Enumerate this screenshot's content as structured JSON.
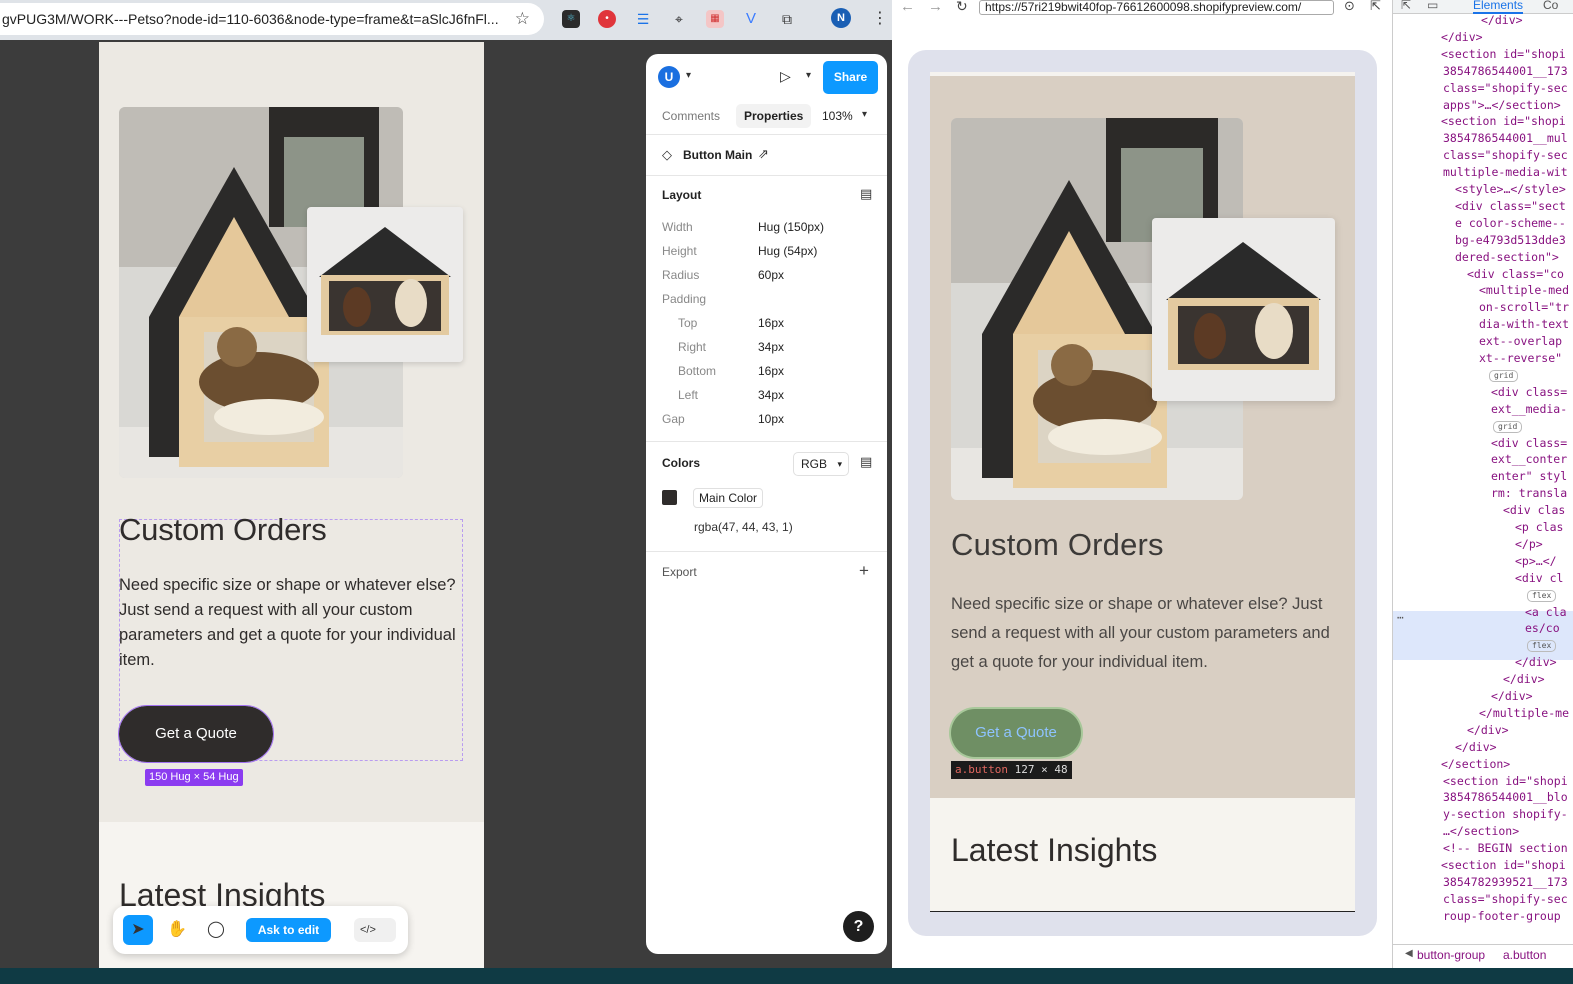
{
  "left_browser": {
    "url": "gvPUG3M/WORK---Petso?node-id=110-6036&node-type=frame&t=aSlcJ6fnFl...",
    "profile_initial": "N"
  },
  "figma_canvas": {
    "heading": "Custom Orders",
    "body": "Need specific size or shape or whatever else? Just send a request with all your custom parameters and get a quote for your individual item.",
    "button_label": "Get a Quote",
    "size_badge": "150 Hug × 54 Hug",
    "next_heading": "Latest Insights"
  },
  "figma_toolbar": {
    "ask_label": "Ask to edit",
    "code_label": "</>"
  },
  "properties_panel": {
    "user_initial": "U",
    "share_label": "Share",
    "tabs": [
      "Comments",
      "Properties"
    ],
    "zoom": "103%",
    "component_name": "Button Main",
    "layout_title": "Layout",
    "layout": [
      {
        "label": "Width",
        "value": "Hug (150px)"
      },
      {
        "label": "Height",
        "value": "Hug (54px)"
      },
      {
        "label": "Radius",
        "value": "60px"
      },
      {
        "label": "Padding",
        "value": ""
      },
      {
        "label": "Top",
        "value": "16px"
      },
      {
        "label": "Right",
        "value": "34px"
      },
      {
        "label": "Bottom",
        "value": "16px"
      },
      {
        "label": "Left",
        "value": "34px"
      },
      {
        "label": "Gap",
        "value": "10px"
      }
    ],
    "colors_title": "Colors",
    "color_mode": "RGB",
    "color_name": "Main Color",
    "color_value": "rgba(47, 44, 43, 1)",
    "color_hex": "#2f2c2b",
    "export_title": "Export",
    "help": "?"
  },
  "right_browser": {
    "url": "https://57ri219bwit40fop-76612600098.shopifypreview.com/",
    "heading": "Custom Orders",
    "body": "Need specific size or shape or whatever else? Just send a request with all your custom parameters and get a quote for your individual item.",
    "button_label": "Get a Quote",
    "tooltip_tag": "a.button",
    "tooltip_size": "127 × 48",
    "next_heading": "Latest Insights"
  },
  "devtools": {
    "tabs": [
      "Elements",
      "Co"
    ],
    "lines": [
      "</div>",
      "</div>",
      "<section id=\"shopi",
      "3854786544001__173",
      "class=\"shopify-sec",
      "apps\">…</section>",
      "<section id=\"shopi",
      "3854786544001__mul",
      "class=\"shopify-sec",
      "multiple-media-wit",
      "<style>…</style>",
      "<div class=\"sect",
      "e color-scheme--",
      "bg-e4793d513dde3",
      "dered-section\">",
      "<div class=\"co",
      "<multiple-med",
      "on-scroll=\"tr",
      "dia-with-text",
      "ext--overlap",
      "xt--reverse\"",
      "grid",
      "<div class=",
      "ext__media-",
      "grid",
      "<div class=",
      "ext__conter",
      "enter\" styl",
      "rm: transla",
      "<div clas",
      "<p clas",
      "</p>",
      "<p>…</",
      "<div cl",
      "flex",
      "<a cla",
      "es/co",
      "flex",
      "</div>",
      "</div>",
      "</div>",
      "</multiple-me",
      "</div>",
      "</div>",
      "</section>",
      "<section id=\"shopi",
      "3854786544001__blo",
      "y-section shopify-",
      "…</section>",
      "<!-- BEGIN section",
      "<section id=\"shopi",
      "3854782939521__173",
      "class=\"shopify-sec",
      "roup-footer-group"
    ],
    "breadcrumb": [
      "button-group",
      "a.button"
    ]
  }
}
